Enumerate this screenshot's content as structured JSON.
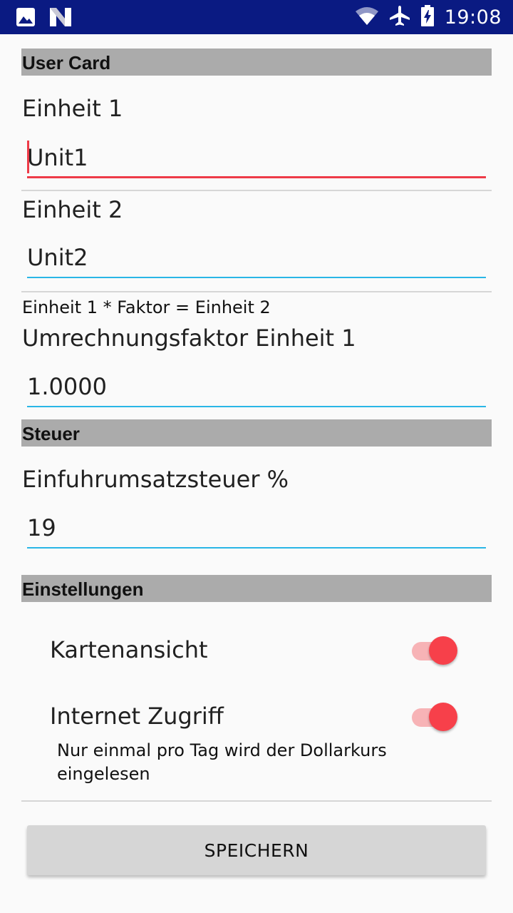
{
  "status_bar": {
    "time": "19:08",
    "left_icons": [
      "image-icon",
      "n-logo-icon"
    ],
    "right_icons": [
      "wifi-icon",
      "airplane-icon",
      "battery-charging-icon"
    ],
    "background_color": "#0a1a82"
  },
  "sections": {
    "user_card": "User Card",
    "tax": "Steuer",
    "settings": "Einstellungen"
  },
  "unit1": {
    "label": "Einheit 1",
    "value": "Unit1"
  },
  "unit2": {
    "label": "Einheit 2",
    "value": "Unit2"
  },
  "conversion": {
    "formula": "Einheit 1 * Faktor = Einheit 2",
    "label": "Umrechnungsfaktor Einheit 1",
    "value": "1.0000"
  },
  "tax": {
    "label": "Einfuhrumsatzsteuer %",
    "value": "19"
  },
  "settings": {
    "card_view": {
      "label": "Kartenansicht",
      "enabled": true
    },
    "internet_access": {
      "label": "Internet Zugriff",
      "enabled": true,
      "hint": "Nur einmal pro Tag wird der Dollarkurs eingelesen"
    }
  },
  "save_button": {
    "label": "SPEICHERN"
  },
  "colors": {
    "accent": "#ee3b48",
    "input_underline": "#29b6e6",
    "section_header": "#ababab",
    "switch_thumb": "#f7404a",
    "switch_track": "#f7b3b6"
  }
}
